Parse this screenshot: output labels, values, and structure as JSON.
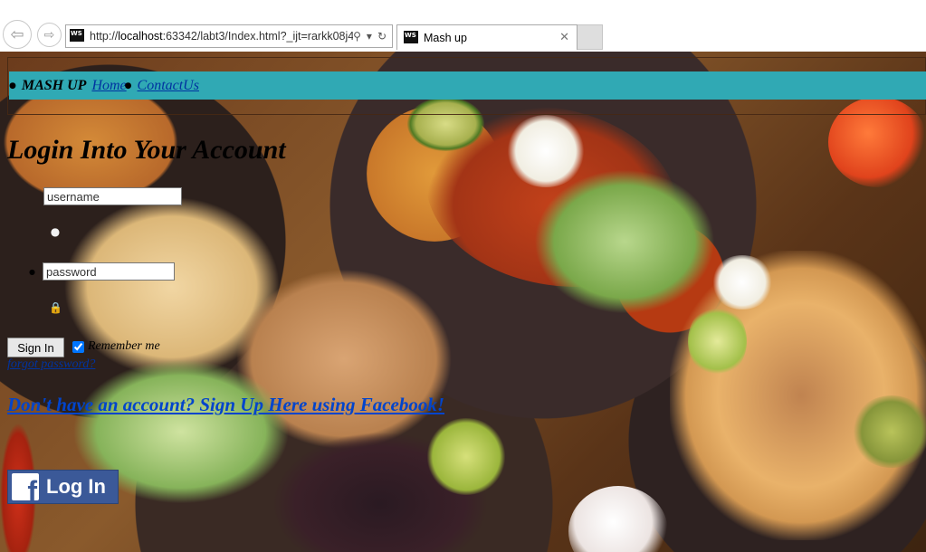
{
  "browser": {
    "url_prefix": "http://",
    "url_host": "localhost",
    "url_rest": ":63342/labt3/Index.html?_ijt=rarkk08j4",
    "tab_title": "Mash up",
    "ws_logo_text": "WS"
  },
  "nav": {
    "brand": "MASH UP",
    "home": "Home",
    "contact": "ContactUs"
  },
  "login": {
    "title": "Login Into Your Account",
    "username_placeholder": "username",
    "password_placeholder": "password",
    "signin_label": "Sign In",
    "remember_label": "Remember me",
    "remember_checked": true,
    "forgot_label": "forgot password?",
    "signup_label": "Don't have an account? Sign Up Here using Facebook!",
    "fb_button_label": "Log In",
    "fb_logo_letter": "f"
  },
  "colors": {
    "nav_bar": "#30a9b4",
    "link": "#0033a0",
    "facebook": "#3b5998"
  },
  "icons": {
    "user": "user-icon",
    "lock": "lock-icon",
    "back": "back-arrow-icon",
    "forward": "forward-arrow-icon",
    "search": "search-icon",
    "refresh": "refresh-icon",
    "close": "close-icon"
  }
}
